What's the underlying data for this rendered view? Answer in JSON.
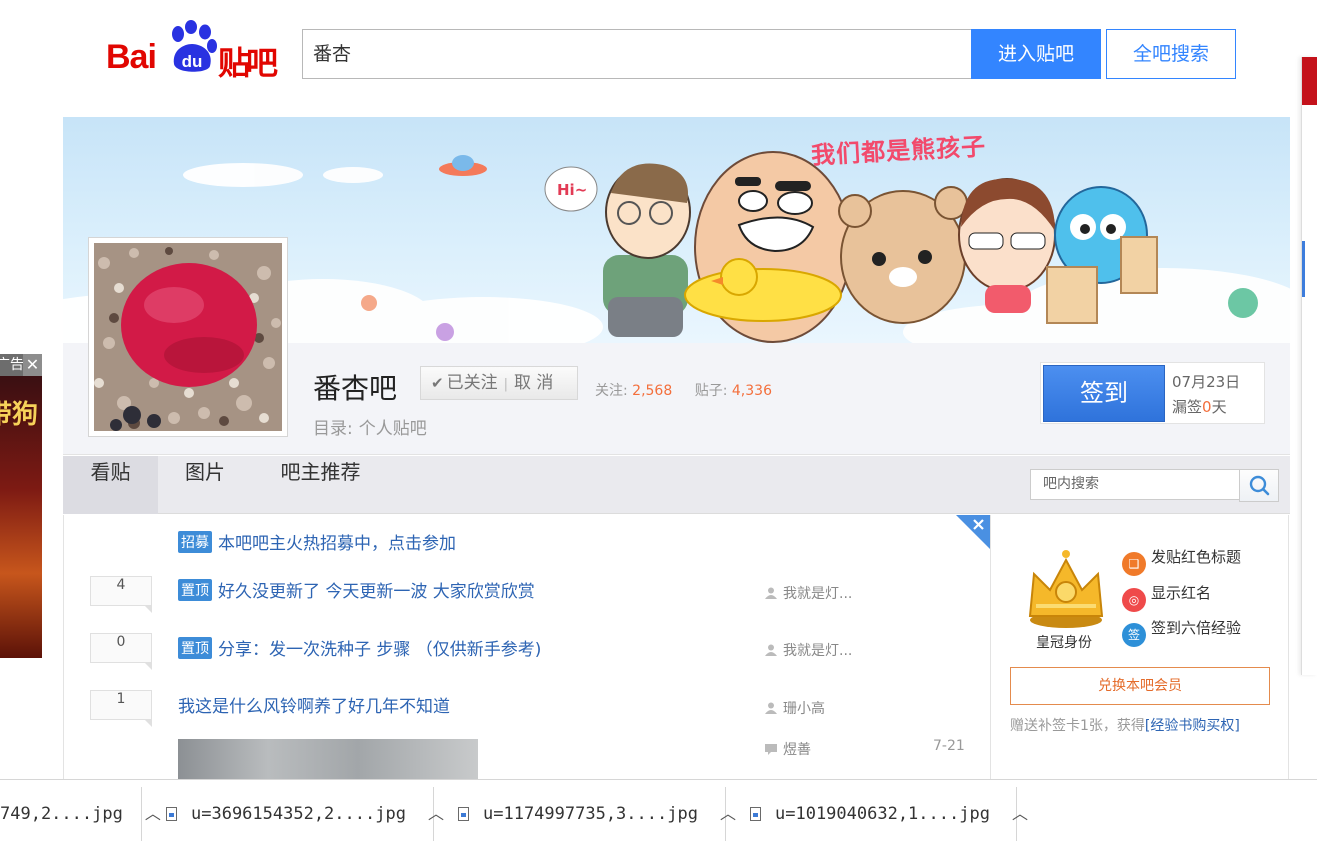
{
  "header": {
    "logo_text_bai": "Bai",
    "logo_text_du": "du",
    "logo_text_tieba": "贴吧",
    "search_value": "番杏",
    "enter_button": "进入贴吧",
    "all_search_button": "全吧搜索"
  },
  "banner": {
    "slogan": "我们都是熊孩子",
    "hi_bubble": "Hi~"
  },
  "forum": {
    "name": "番杏吧",
    "follow_state": "已关注",
    "unfollow": "取 消",
    "followers_label": "关注:",
    "followers_count": "2,568",
    "posts_label": "贴子:",
    "posts_count": "4,336",
    "directory_label": "目录:",
    "directory_value": "个人贴吧"
  },
  "sign": {
    "button": "签到",
    "date": "07月23日",
    "miss_prefix": "漏签",
    "miss_count": "0",
    "miss_suffix": "天"
  },
  "nav": {
    "tabs": [
      {
        "label": "看贴"
      },
      {
        "label": "图片"
      },
      {
        "label": "吧主推荐"
      }
    ],
    "inner_search_placeholder": "吧内搜索"
  },
  "threads": [
    {
      "badge": "招募",
      "title": "本吧吧主火热招募中，点击参加",
      "replies": "",
      "author": ""
    },
    {
      "badge": "置顶",
      "title": "好久没更新了 今天更新一波 大家欣赏欣赏",
      "replies": "4",
      "author": "我就是灯..."
    },
    {
      "badge": "置顶",
      "title": "分享：发一次洗种子 步骤 （仅供新手参考)",
      "replies": "0",
      "author": "我就是灯..."
    },
    {
      "badge": "",
      "title": "我这是什么风铃啊养了好几年不知道",
      "replies": "1",
      "author": "珊小高",
      "last_reply_user": "煜善",
      "last_reply_date": "7-21"
    }
  ],
  "sidebar": {
    "crown_label": "皇冠身份",
    "perks": [
      {
        "icon": "bookmark-icon",
        "label": "发贴红色标题",
        "color": "#f07a2a"
      },
      {
        "icon": "red-name-icon",
        "label": "显示红名",
        "color": "#ef4a4a"
      },
      {
        "icon": "sign-exp-icon",
        "label": "签到六倍经验",
        "color": "#2e90d8",
        "glyph": "签"
      }
    ],
    "exchange_button": "兑换本吧会员",
    "gift_text": "赠送补签卡1张，获得",
    "gift_link": "[经验书购买权]"
  },
  "ad": {
    "label": "广告",
    "close": "✕",
    "text": "带狗"
  },
  "downloads": [
    {
      "name": "749,2....jpg"
    },
    {
      "name": "u=3696154352,2....jpg"
    },
    {
      "name": "u=1174997735,3....jpg"
    },
    {
      "name": "u=1019040632,1....jpg"
    }
  ],
  "colors": {
    "brand_red": "#e10601",
    "link_blue": "#2d64b3",
    "button_blue": "#3385ff",
    "stat_orange": "#f36f3c"
  }
}
